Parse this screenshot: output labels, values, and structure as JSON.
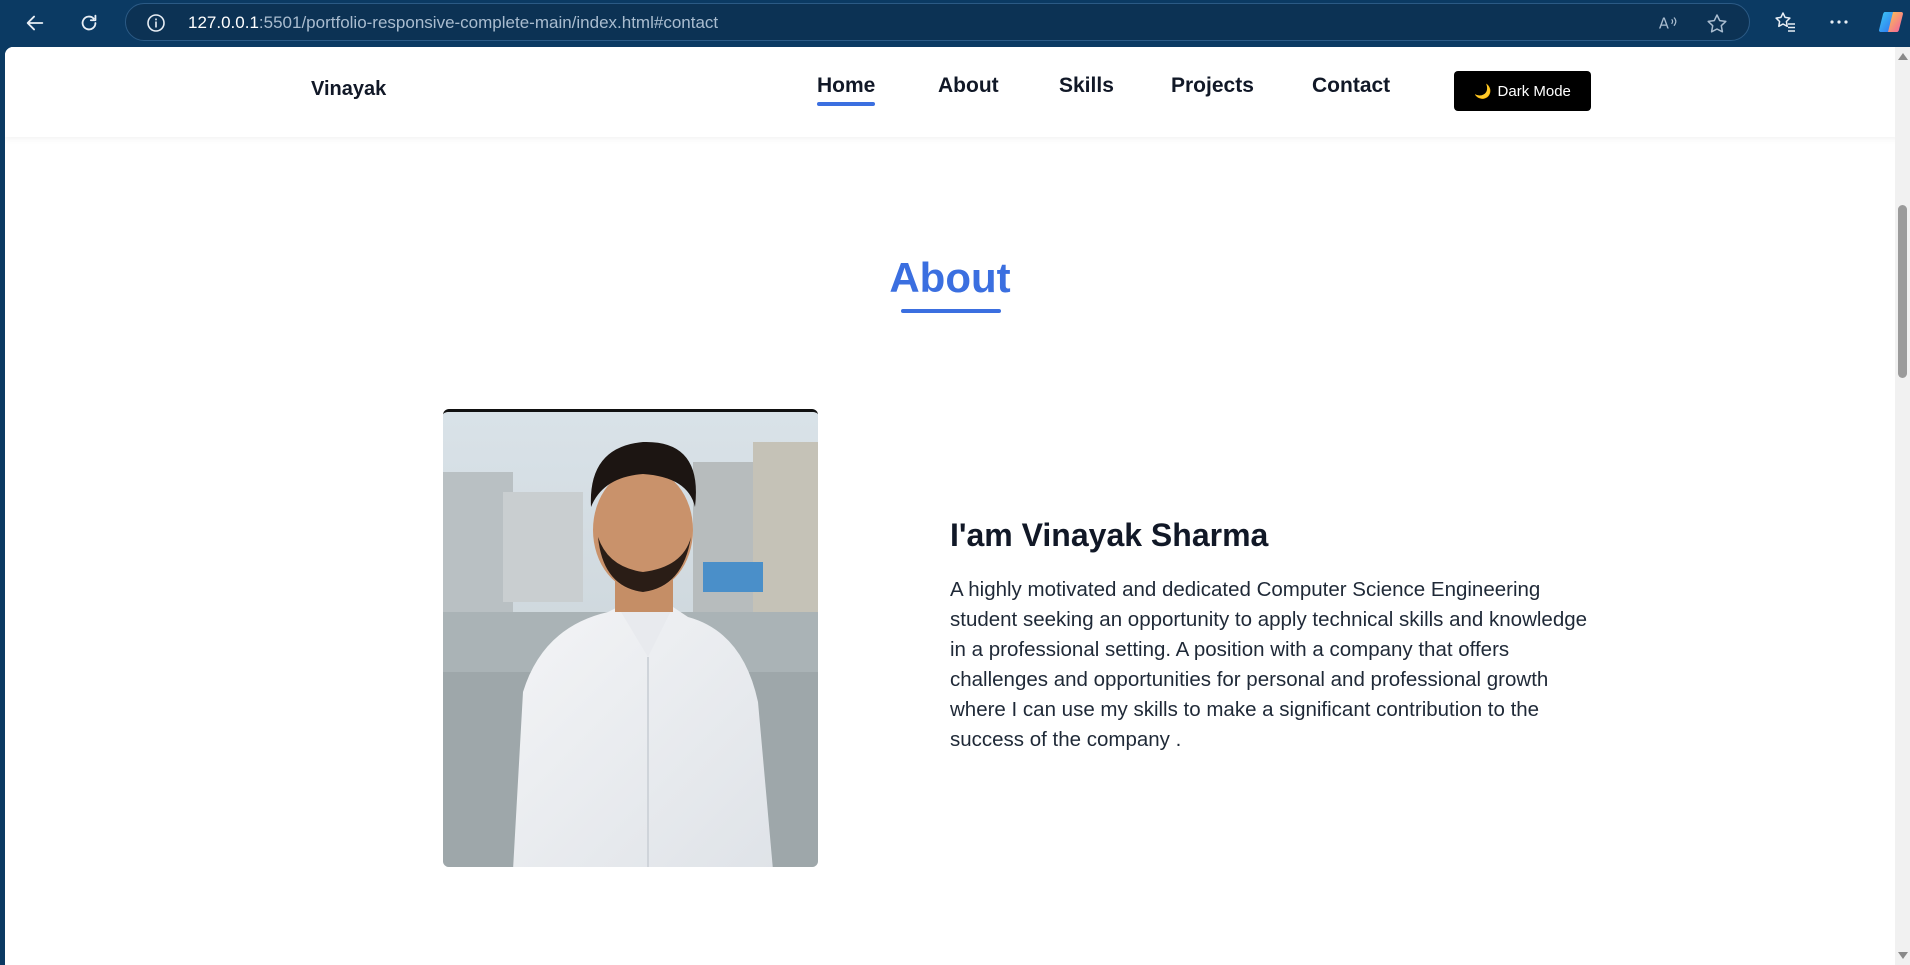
{
  "browser": {
    "url_host": "127.0.0.1",
    "url_rest": ":5501/portfolio-responsive-complete-main/index.html#contact",
    "icons": [
      "back-arrow-icon",
      "reload-icon",
      "info-icon",
      "read-aloud-icon",
      "favorite-star-icon",
      "favorites-icon",
      "more-icon",
      "copilot-icon"
    ]
  },
  "navbar": {
    "logo": "Vinayak",
    "links": [
      "Home",
      "About",
      "Skills",
      "Projects",
      "Contact"
    ],
    "active": "Home",
    "dark_mode_label": "Dark Mode"
  },
  "about": {
    "title": "About",
    "name": "I'am Vinayak Sharma",
    "description": "A highly motivated and dedicated Computer Science Engineering student seeking an opportunity to apply technical skills and knowledge in a professional setting. A position with a company that offers challenges and opportunities for personal and professional growth where I can use my skills to make a significant contribution to the success of the company ."
  },
  "colors": {
    "accent": "#3b6fe0",
    "chrome": "#0b3a63",
    "text": "#111827"
  }
}
